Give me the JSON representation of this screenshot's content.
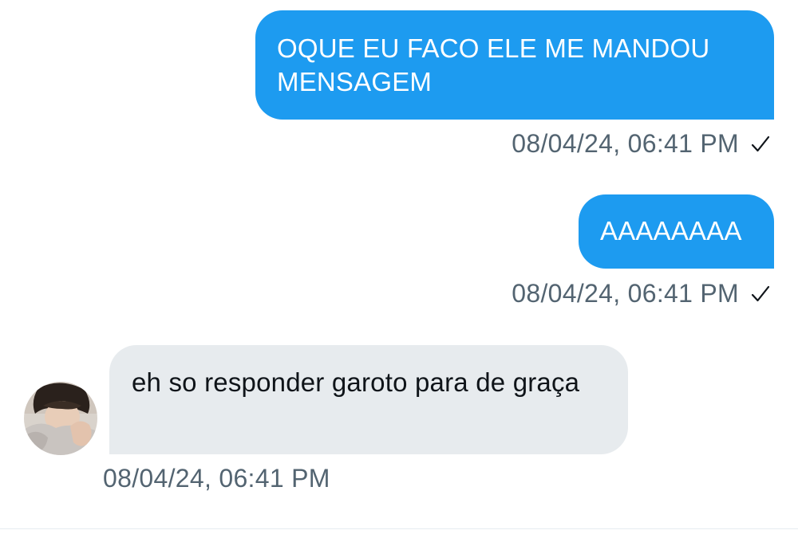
{
  "messages": [
    {
      "direction": "outgoing",
      "text": "OQUE EU FACO ELE ME MANDOU MENSAGEM",
      "timestamp": "08/04/24, 06:41 PM",
      "status_icon": "checkmark-icon"
    },
    {
      "direction": "outgoing",
      "text": "AAAAAAAA",
      "timestamp": "08/04/24, 06:41 PM",
      "status_icon": "checkmark-icon"
    },
    {
      "direction": "incoming",
      "text": "eh so responder garoto para de graça",
      "timestamp": "08/04/24, 06:41 PM",
      "avatar": "sender-avatar"
    }
  ],
  "colors": {
    "outgoing_bubble": "#1d9bf0",
    "incoming_bubble": "#e7ebee",
    "timestamp_text": "#536471"
  }
}
